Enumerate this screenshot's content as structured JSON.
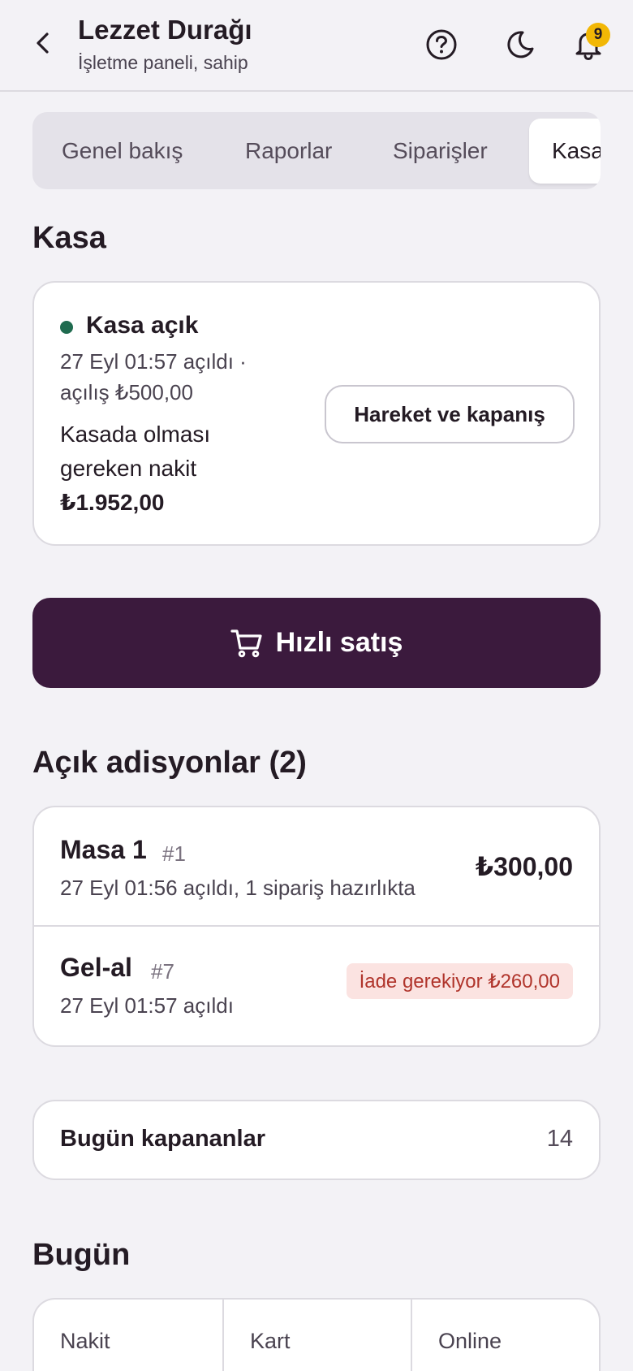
{
  "header": {
    "title": "Lezzet Durağı",
    "subtitle": "İşletme paneli, sahip",
    "notification_count": "9"
  },
  "tabs": [
    {
      "label": "Genel bakış"
    },
    {
      "label": "Raporlar"
    },
    {
      "label": "Siparişler"
    },
    {
      "label": "Kasa",
      "active": true
    }
  ],
  "kasa": {
    "section_title": "Kasa",
    "status": "Kasa açık",
    "status_color": "#1f6b4f",
    "opened_line1": "27 Eyl 01:57 açıldı ·",
    "opened_line2": "açılış ₺500,00",
    "expected_line1": "Kasada olması",
    "expected_line2": "gereken nakit",
    "expected_amount": "₺1.952,00",
    "movement_button": "Hareket ve kapanış"
  },
  "quick_sale": {
    "label": "Hızlı satış",
    "color": "#3b1a3d"
  },
  "open_tabs": {
    "section_title": "Açık adisyonlar (2)",
    "items": [
      {
        "name": "Masa 1",
        "number": "#1",
        "subtitle": "27 Eyl 01:56 açıldı, 1 sipariş hazırlıkta",
        "amount": "₺300,00"
      },
      {
        "name": "Gel-al",
        "number": "#7",
        "subtitle": "27 Eyl 01:57 açıldı",
        "refund": "İade gerekiyor ₺260,00"
      }
    ]
  },
  "closed_today": {
    "label": "Bugün kapananlar",
    "count": "14"
  },
  "today": {
    "section_title": "Bugün",
    "payment_types": [
      "Nakit",
      "Kart",
      "Online"
    ]
  }
}
